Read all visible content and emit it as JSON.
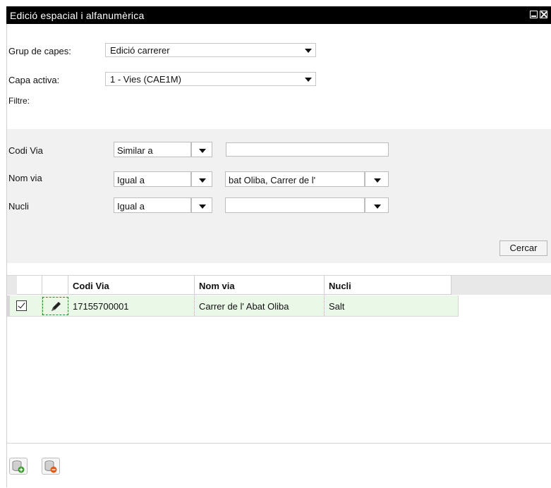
{
  "window": {
    "title": "Edició espacial i alfanumèrica",
    "minimize_icon": "minimize-icon",
    "close_icon": "close-icon"
  },
  "form": {
    "grup_label": "Grup de capes:",
    "grup_value": "Edició carrerer",
    "capa_label": "Capa activa:",
    "capa_value": "1 - Vies (CAE1M)",
    "filtre_label": "Filtre:"
  },
  "filters": [
    {
      "label": "Codi Via",
      "operator": "Similar a",
      "value": "",
      "value_type": "text"
    },
    {
      "label": "Nom via",
      "operator": "Igual a",
      "value": "bat Oliba, Carrer de l'",
      "value_type": "select"
    },
    {
      "label": "Nucli",
      "operator": "Igual a",
      "value": "",
      "value_type": "select"
    }
  ],
  "search_button": "Cercar",
  "table": {
    "columns": [
      "Codi Via",
      "Nom via",
      "Nucli"
    ],
    "rows": [
      {
        "checked": true,
        "codi_via": "17155700001",
        "nom_via": "Carrer de l' Abat Oliba",
        "nucli": "Salt"
      }
    ]
  },
  "toolbar": {
    "add_icon": "database-add-icon",
    "delete_icon": "database-delete-icon"
  },
  "colors": {
    "titlebar": "#000000",
    "filter_panel": "#f1f1f1",
    "selected_row": "#eaf8e8",
    "add_accent": "#3a9a2a",
    "delete_accent": "#e05a1a"
  }
}
